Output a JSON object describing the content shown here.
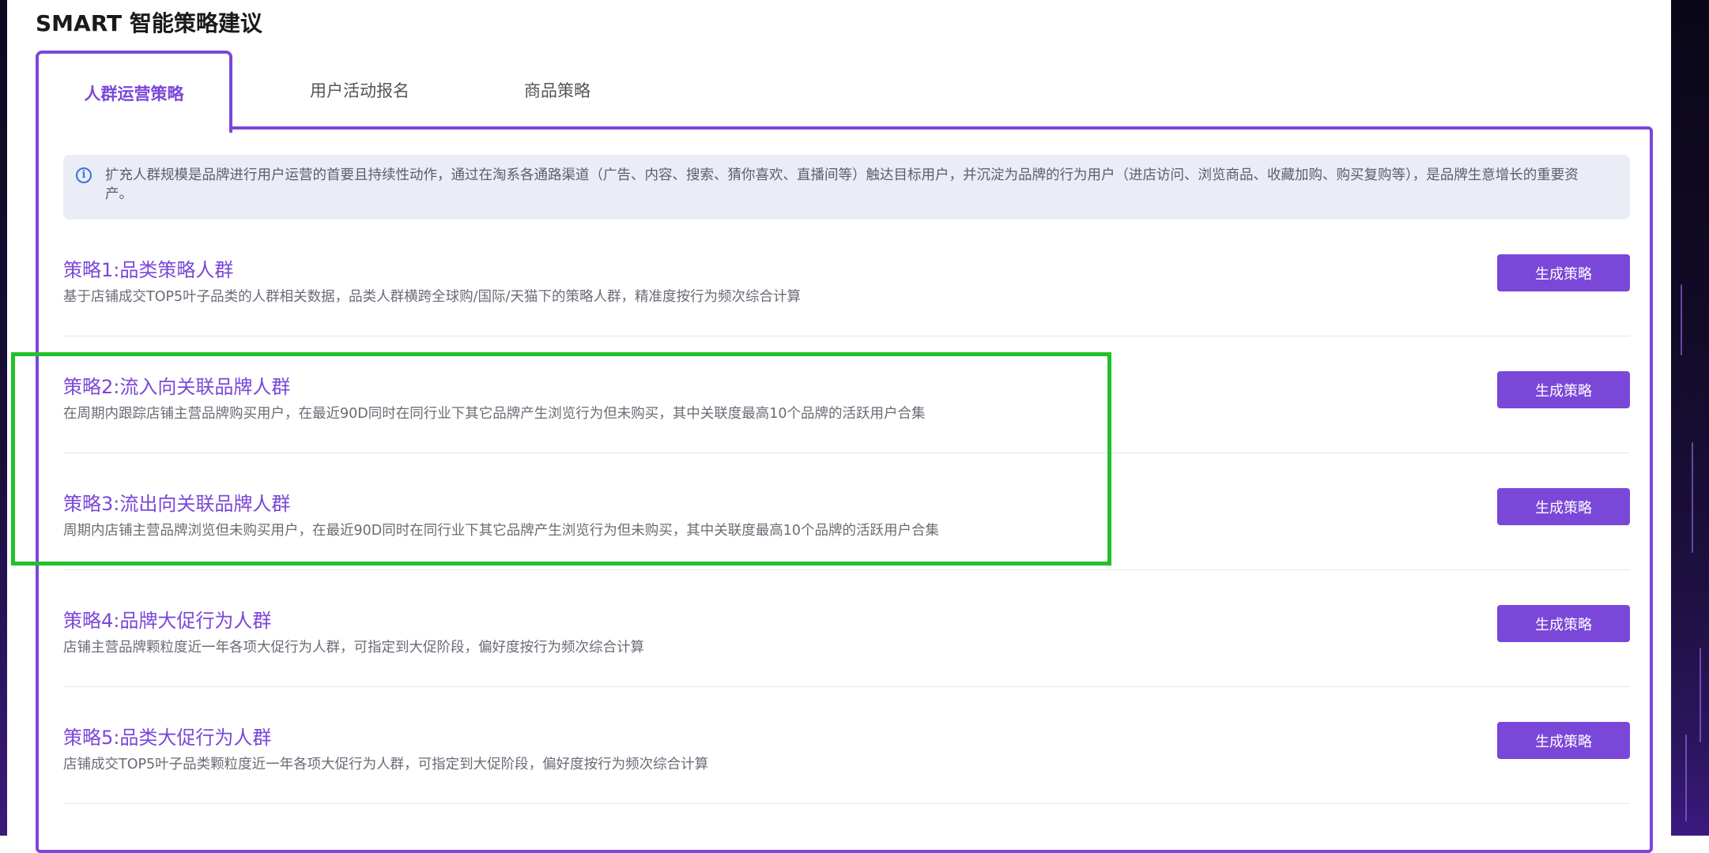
{
  "page_title": "SMART 智能策略建议",
  "tabs": [
    {
      "label": "人群运营策略",
      "active": true
    },
    {
      "label": "用户活动报名",
      "active": false
    },
    {
      "label": "商品策略",
      "active": false
    }
  ],
  "info": {
    "icon": "info-icon",
    "text": "扩充人群规模是品牌进行用户运营的首要且持续性动作，通过在淘系各通路渠道（广告、内容、搜索、猜你喜欢、直播间等）触达目标用户，并沉淀为品牌的行为用户（进店访问、浏览商品、收藏加购、购买复购等），是品牌生意增长的重要资产。"
  },
  "strategies": [
    {
      "title": "策略1:品类策略人群",
      "desc": "基于店铺成交TOP5叶子品类的人群相关数据，品类人群横跨全球购/国际/天猫下的策略人群，精准度按行为频次综合计算",
      "button": "生成策略"
    },
    {
      "title": "策略2:流入向关联品牌人群",
      "desc": "在周期内跟踪店铺主营品牌购买用户，在最近90D同时在同行业下其它品牌产生浏览行为但未购买，其中关联度最高10个品牌的活跃用户合集",
      "button": "生成策略"
    },
    {
      "title": "策略3:流出向关联品牌人群",
      "desc": "周期内店铺主营品牌浏览但未购买用户，在最近90D同时在同行业下其它品牌产生浏览行为但未购买，其中关联度最高10个品牌的活跃用户合集",
      "button": "生成策略"
    },
    {
      "title": "策略4:品牌大促行为人群",
      "desc": "店铺主营品牌颗粒度近一年各项大促行为人群，可指定到大促阶段，偏好度按行为频次综合计算",
      "button": "生成策略"
    },
    {
      "title": "策略5:品类大促行为人群",
      "desc": "店铺成交TOP5叶子品类颗粒度近一年各项大促行为人群，可指定到大促阶段，偏好度按行为频次综合计算",
      "button": "生成策略"
    }
  ],
  "colors": {
    "accent": "#7b47d9",
    "highlight": "#22c02a",
    "info_bg": "#eaedf5"
  }
}
